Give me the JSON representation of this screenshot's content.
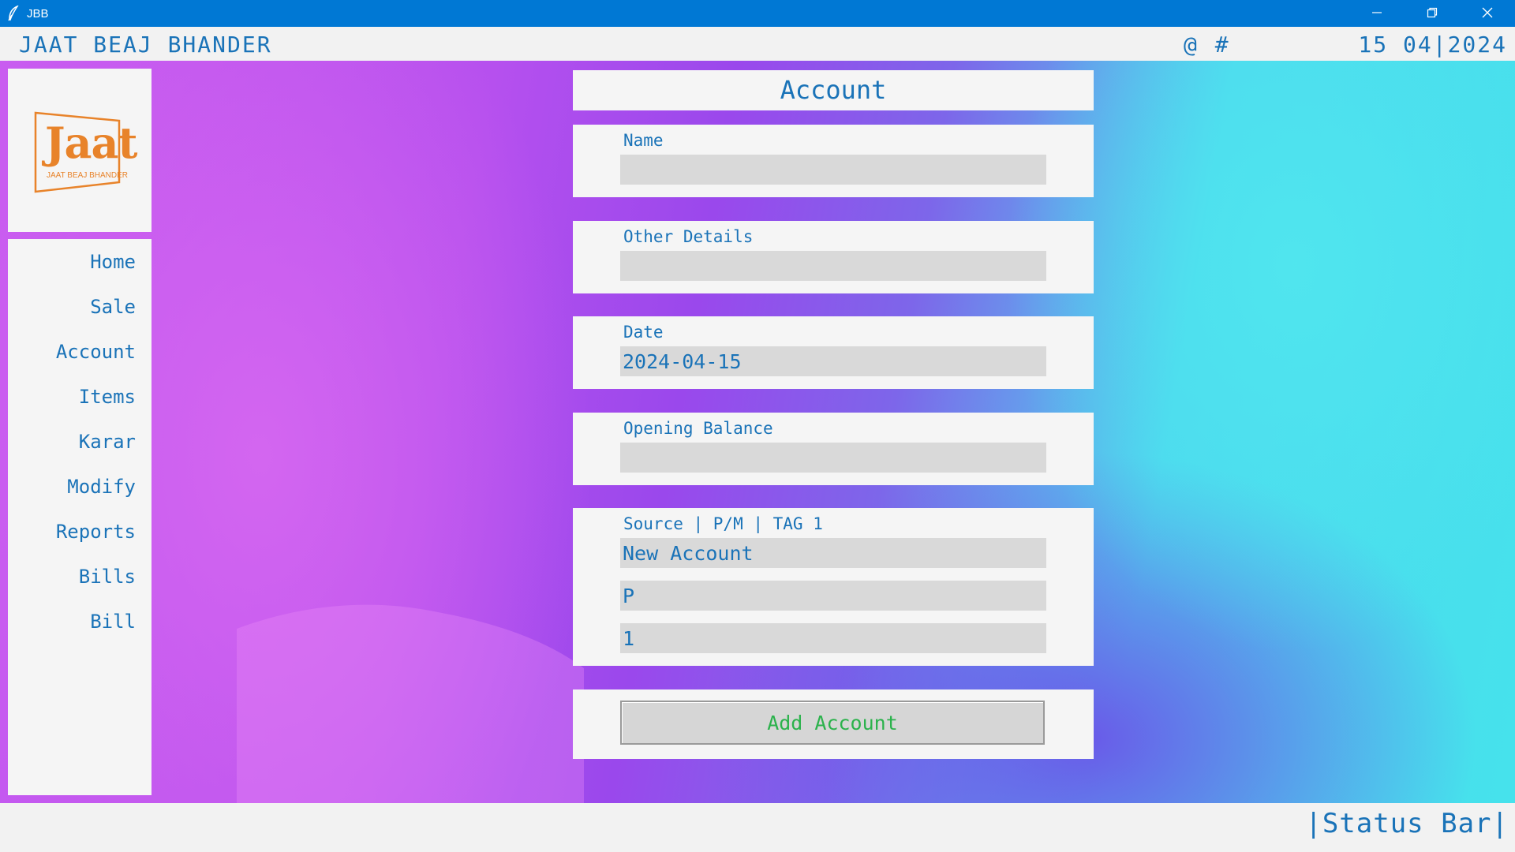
{
  "window": {
    "title": "JBB",
    "icon": "feather-icon",
    "controls": [
      "minimize-icon",
      "restore-icon",
      "close-icon"
    ]
  },
  "header": {
    "app_name": "JAAT BEAJ BHANDER",
    "symbols": "@ #",
    "date": "15 04|2024"
  },
  "logo": {
    "word": "Jaat",
    "tagline": "JAAT BEAJ BHANDER",
    "color": "#e8832a"
  },
  "sidebar": {
    "items": [
      {
        "label": "Home"
      },
      {
        "label": "Sale"
      },
      {
        "label": "Account"
      },
      {
        "label": "Items"
      },
      {
        "label": "Karar"
      },
      {
        "label": "Modify"
      },
      {
        "label": "Reports"
      },
      {
        "label": "Bills"
      },
      {
        "label": "Bill"
      }
    ]
  },
  "form": {
    "title": "Account",
    "name": {
      "label": "Name",
      "value": ""
    },
    "other_details": {
      "label": "Other Details",
      "value": ""
    },
    "date": {
      "label": "Date",
      "value": "2024-04-15"
    },
    "opening_balance": {
      "label": "Opening Balance",
      "value": ""
    },
    "source": {
      "label": "Source | P/M | TAG 1",
      "source_value": "New Account",
      "pm_value": "P",
      "tag_value": "1"
    },
    "submit_label": "Add Account"
  },
  "status_bar": {
    "text": "|Status Bar|"
  },
  "colors": {
    "title_bar": "#0078d4",
    "text_accent": "#1a73b8",
    "button_text": "#2bb24c",
    "input_bg": "#d9d9d9"
  }
}
